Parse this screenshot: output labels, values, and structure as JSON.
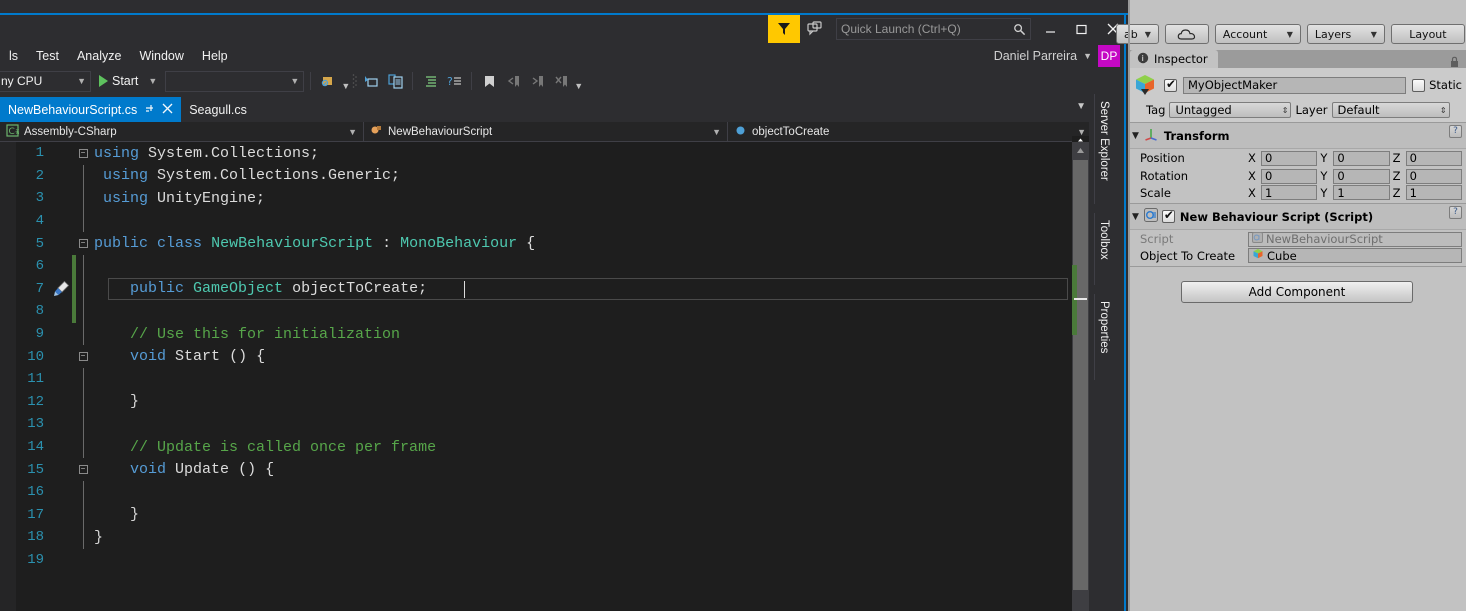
{
  "vs": {
    "titlebar": {
      "feedback_flag_icon": "feedback-flag-icon",
      "feedback_bubble_icon": "feedback-bubble-icon",
      "quick_launch_placeholder": "Quick Launch (Ctrl+Q)",
      "quick_launch_value": "",
      "search_icon": "search-icon",
      "minimize_label": "—",
      "maximize_label": "❐",
      "close_label": "✕"
    },
    "menu": [
      {
        "label": "ls"
      },
      {
        "label": "Test"
      },
      {
        "label": "Analyze"
      },
      {
        "label": "Window"
      },
      {
        "label": "Help"
      }
    ],
    "account": {
      "name": "Daniel Parreira",
      "caret": "▼",
      "initials": "DP"
    },
    "toolbar": {
      "platform": "ny CPU",
      "start_label": "Start",
      "start_caret": "▼",
      "search_box_value": "",
      "overflow_caret": "▼",
      "icons": [
        "find-in-files-icon",
        "step-into-icon",
        "compare-files-icon",
        "indent-icon",
        "comment-icon",
        "bookmark-icon",
        "prev-bookmark-icon",
        "next-bookmark-icon",
        "clear-bookmarks-icon"
      ]
    },
    "tabs": [
      {
        "label": "NewBehaviourScript.cs",
        "active": true,
        "pin": "⤓",
        "close": "✕"
      },
      {
        "label": "Seagull.cs",
        "active": false
      }
    ],
    "tabs_overflow_caret": "▼",
    "navbar": [
      {
        "icon": "csharp-project-icon",
        "label": "Assembly-CSharp",
        "caret": "▼"
      },
      {
        "icon": "class-icon",
        "label": "NewBehaviourScript",
        "caret": "▼"
      },
      {
        "icon": "field-icon",
        "label": "objectToCreate",
        "caret": "▼"
      }
    ],
    "vertical_tabs": [
      {
        "label": "Server Explorer"
      },
      {
        "label": "Toolbox"
      },
      {
        "label": "Properties"
      }
    ],
    "editor": {
      "glyph_line7_icon": "quick-actions-brush-icon",
      "scroll_up_arrow": "▲",
      "split_handle_icon": "split-view-icon",
      "lines": [
        {
          "n": 1,
          "fold": "minus",
          "change": false,
          "tokens": [
            {
              "t": "k",
              "v": "using"
            },
            {
              "t": "p",
              "v": " System.Collections;"
            }
          ]
        },
        {
          "n": 2,
          "fold": "bar",
          "change": false,
          "tokens": [
            {
              "t": "k",
              "v": " using"
            },
            {
              "t": "p",
              "v": " System.Collections.Generic;"
            }
          ]
        },
        {
          "n": 3,
          "fold": "bar",
          "change": false,
          "tokens": [
            {
              "t": "k",
              "v": " using"
            },
            {
              "t": "p",
              "v": " UnityEngine;"
            }
          ]
        },
        {
          "n": 4,
          "fold": "end",
          "change": false,
          "tokens": [
            {
              "t": "p",
              "v": ""
            }
          ]
        },
        {
          "n": 5,
          "fold": "minus",
          "change": false,
          "tokens": [
            {
              "t": "k",
              "v": "public"
            },
            {
              "t": "p",
              "v": " "
            },
            {
              "t": "k",
              "v": "class"
            },
            {
              "t": "p",
              "v": " "
            },
            {
              "t": "t",
              "v": "NewBehaviourScript"
            },
            {
              "t": "p",
              "v": " : "
            },
            {
              "t": "t",
              "v": "MonoBehaviour"
            },
            {
              "t": "p",
              "v": " {"
            }
          ]
        },
        {
          "n": 6,
          "fold": "bar",
          "change": true,
          "tokens": [
            {
              "t": "p",
              "v": ""
            }
          ]
        },
        {
          "n": 7,
          "fold": "bar",
          "change": true,
          "current": true,
          "tokens": [
            {
              "t": "p",
              "v": "    "
            },
            {
              "t": "k",
              "v": "public"
            },
            {
              "t": "p",
              "v": " "
            },
            {
              "t": "t",
              "v": "GameObject"
            },
            {
              "t": "p",
              "v": " objectToCreate;"
            }
          ]
        },
        {
          "n": 8,
          "fold": "bar",
          "change": true,
          "tokens": [
            {
              "t": "p",
              "v": ""
            }
          ]
        },
        {
          "n": 9,
          "fold": "bar",
          "change": false,
          "tokens": [
            {
              "t": "p",
              "v": "    "
            },
            {
              "t": "c",
              "v": "// Use this for initialization"
            }
          ]
        },
        {
          "n": 10,
          "fold": "minus",
          "change": false,
          "tokens": [
            {
              "t": "p",
              "v": "    "
            },
            {
              "t": "k",
              "v": "void"
            },
            {
              "t": "p",
              "v": " "
            },
            {
              "t": "p",
              "v": "Start"
            },
            {
              "t": "p",
              "v": " () {"
            }
          ]
        },
        {
          "n": 11,
          "fold": "bar",
          "change": false,
          "tokens": [
            {
              "t": "p",
              "v": ""
            }
          ]
        },
        {
          "n": 12,
          "fold": "end",
          "change": false,
          "tokens": [
            {
              "t": "p",
              "v": "    "
            },
            {
              "t": "b",
              "v": "}"
            }
          ]
        },
        {
          "n": 13,
          "fold": "bar",
          "change": false,
          "tokens": [
            {
              "t": "p",
              "v": ""
            }
          ]
        },
        {
          "n": 14,
          "fold": "bar",
          "change": false,
          "tokens": [
            {
              "t": "p",
              "v": "    "
            },
            {
              "t": "c",
              "v": "// Update is called once per frame"
            }
          ]
        },
        {
          "n": 15,
          "fold": "minus",
          "change": false,
          "tokens": [
            {
              "t": "p",
              "v": "    "
            },
            {
              "t": "k",
              "v": "void"
            },
            {
              "t": "p",
              "v": " "
            },
            {
              "t": "p",
              "v": "Update"
            },
            {
              "t": "p",
              "v": " () {"
            }
          ]
        },
        {
          "n": 16,
          "fold": "bar",
          "change": false,
          "tokens": [
            {
              "t": "p",
              "v": ""
            }
          ]
        },
        {
          "n": 17,
          "fold": "end",
          "change": false,
          "tokens": [
            {
              "t": "p",
              "v": "    "
            },
            {
              "t": "b",
              "v": "}"
            }
          ]
        },
        {
          "n": 18,
          "fold": "end",
          "change": false,
          "tokens": [
            {
              "t": "b",
              "v": "}"
            }
          ]
        },
        {
          "n": 19,
          "fold": "none",
          "change": false,
          "tokens": [
            {
              "t": "p",
              "v": ""
            }
          ]
        }
      ]
    },
    "colors": {
      "accent": "#007acc",
      "editor_bg": "#1e1e1e",
      "chrome_bg": "#2d2d30",
      "keyword": "#569cd6",
      "type": "#4ec9b0",
      "comment": "#57a64a",
      "linenumber": "#2b91af",
      "feedback_flag": "#ffc800",
      "avatar": "#c408c4",
      "change_bar": "#4a7a3a"
    }
  },
  "unity": {
    "toolbar": {
      "collab_label": "ab",
      "collab_caret": "▼",
      "cloud_icon": "cloud-icon",
      "account_label": "Account",
      "account_caret": "▼",
      "layers_label": "Layers",
      "layers_caret": "▼",
      "layout_label": "Layout"
    },
    "tab": {
      "icon": "inspector-info-icon",
      "label": "Inspector",
      "lock_icon": "lock-icon"
    },
    "gameobject": {
      "icon": "gameobject-cube-icon",
      "enabled": true,
      "name": "MyObjectMaker",
      "static_label": "Static",
      "static_checked": false,
      "tag_label": "Tag",
      "tag_value": "Untagged",
      "layer_label": "Layer",
      "layer_value": "Default"
    },
    "components": [
      {
        "name": "Transform",
        "icon": "transform-axis-icon",
        "foldout": "▼",
        "help": "?",
        "rows": [
          {
            "label": "Position",
            "fields": [
              {
                "axis": "X",
                "value": "0"
              },
              {
                "axis": "Y",
                "value": "0"
              },
              {
                "axis": "Z",
                "value": "0"
              }
            ]
          },
          {
            "label": "Rotation",
            "fields": [
              {
                "axis": "X",
                "value": "0"
              },
              {
                "axis": "Y",
                "value": "0"
              },
              {
                "axis": "Z",
                "value": "0"
              }
            ]
          },
          {
            "label": "Scale",
            "fields": [
              {
                "axis": "X",
                "value": "1"
              },
              {
                "axis": "Y",
                "value": "1"
              },
              {
                "axis": "Z",
                "value": "1"
              }
            ]
          }
        ]
      },
      {
        "name": "New Behaviour Script (Script)",
        "icon": "csharp-script-icon",
        "foldout": "▼",
        "enabled": true,
        "help": "?",
        "object_rows": [
          {
            "label": "Script",
            "value": "NewBehaviourScript",
            "icon": "script-asset-icon",
            "dim": true
          },
          {
            "label": "Object To Create",
            "value": "Cube",
            "icon": "prefab-cube-icon",
            "dim": false
          }
        ]
      }
    ],
    "add_component_label": "Add Component"
  }
}
